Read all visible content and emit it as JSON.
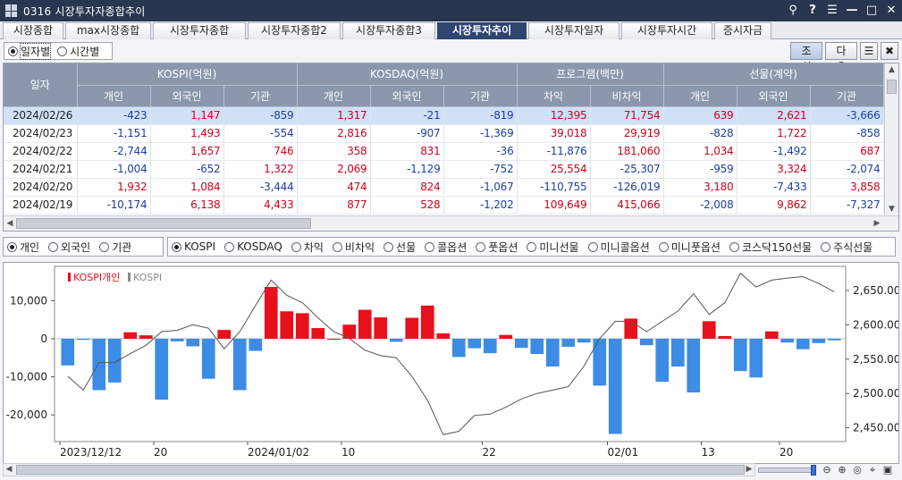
{
  "window": {
    "title": "0316 시장투자자종합추이",
    "buttons": [
      "pin",
      "?",
      "≡",
      "—",
      "□",
      "✕"
    ]
  },
  "tabs": [
    {
      "label": "시장종합",
      "active": false
    },
    {
      "label": "max시장종합",
      "active": false
    },
    {
      "label": "시장투자종합",
      "active": false
    },
    {
      "label": "시장투자종합2",
      "active": false
    },
    {
      "label": "시장투자종합3",
      "active": false
    },
    {
      "label": "시장투자추이",
      "active": true
    },
    {
      "label": "시장투자일자",
      "active": false
    },
    {
      "label": "시장투자시간",
      "active": false
    },
    {
      "label": "증시자금",
      "active": false
    }
  ],
  "toolbar": {
    "mode_options": [
      {
        "label": "일자별",
        "selected": true
      },
      {
        "label": "시간별",
        "selected": false
      }
    ],
    "query_label": "조회",
    "next_label": "다음"
  },
  "table": {
    "date_header": "일자",
    "groups": [
      "KOSPI(억원)",
      "KOSDAQ(억원)",
      "프로그램(백만)",
      "선물(계약)"
    ],
    "subheaders": [
      "개인",
      "외국인",
      "기관",
      "개인",
      "외국인",
      "기관",
      "차익",
      "비차익",
      "개인",
      "외국인",
      "기관"
    ],
    "rows": [
      {
        "date": "2024/02/26",
        "values": [
          "-423",
          "1,147",
          "-859",
          "1,317",
          "-21",
          "-819",
          "12,395",
          "71,754",
          "639",
          "2,621",
          "-3,666"
        ]
      },
      {
        "date": "2024/02/23",
        "values": [
          "-1,151",
          "1,493",
          "-554",
          "2,816",
          "-907",
          "-1,369",
          "39,018",
          "29,919",
          "-828",
          "1,722",
          "-858"
        ]
      },
      {
        "date": "2024/02/22",
        "values": [
          "-2,744",
          "1,657",
          "746",
          "358",
          "831",
          "-36",
          "-11,876",
          "181,060",
          "1,034",
          "-1,492",
          "687"
        ]
      },
      {
        "date": "2024/02/21",
        "values": [
          "-1,004",
          "-652",
          "1,322",
          "2,069",
          "-1,129",
          "-752",
          "25,554",
          "-25,307",
          "-959",
          "3,324",
          "-2,074"
        ]
      },
      {
        "date": "2024/02/20",
        "values": [
          "1,932",
          "1,084",
          "-3,444",
          "474",
          "824",
          "-1,067",
          "-110,755",
          "-126,019",
          "3,180",
          "-7,433",
          "3,858"
        ]
      },
      {
        "date": "2024/02/19",
        "values": [
          "-10,174",
          "6,138",
          "4,433",
          "877",
          "528",
          "-1,202",
          "109,649",
          "415,066",
          "-2,008",
          "9,862",
          "-7,327"
        ]
      }
    ]
  },
  "investor_options": [
    {
      "label": "개인",
      "selected": true
    },
    {
      "label": "외국인",
      "selected": false
    },
    {
      "label": "기관",
      "selected": false
    }
  ],
  "market_options": [
    {
      "label": "KOSPI",
      "selected": true
    },
    {
      "label": "KOSDAQ",
      "selected": false
    },
    {
      "label": "차익",
      "selected": false
    },
    {
      "label": "비차익",
      "selected": false
    },
    {
      "label": "선물",
      "selected": false
    },
    {
      "label": "콜옵션",
      "selected": false
    },
    {
      "label": "풋옵션",
      "selected": false
    },
    {
      "label": "미니선물",
      "selected": false
    },
    {
      "label": "미니콜옵션",
      "selected": false
    },
    {
      "label": "미니풋옵션",
      "selected": false
    },
    {
      "label": "코스닥150선물",
      "selected": false
    },
    {
      "label": "주식선물",
      "selected": false
    }
  ],
  "colors": {
    "positive": "#d0021b",
    "negative": "#1d3ea8",
    "bar_up": "#e8101a",
    "bar_down": "#3c8ce6",
    "line": "#555555"
  },
  "chart_data": {
    "type": "bar",
    "legend": [
      {
        "name": "KOSPI개인",
        "color": "#e8101a"
      },
      {
        "name": "KOSPI",
        "color": "#888888"
      }
    ],
    "x_tick_labels": [
      "2023/12/12",
      "20",
      "2024/01/02",
      "10",
      "22",
      "02/01",
      "13",
      "20"
    ],
    "x_tick_index": [
      0,
      6,
      12,
      18,
      27,
      35,
      41,
      46
    ],
    "y_left": {
      "ticks": [
        10000,
        0,
        -10000,
        -20000
      ],
      "tick_labels": [
        "10,000",
        "0",
        "-10,000",
        "-20,000"
      ],
      "range": [
        -27000,
        19000
      ]
    },
    "y_right": {
      "ticks": [
        2650,
        2600,
        2550,
        2500,
        2450
      ],
      "tick_labels": [
        "2,650.00",
        "2,600.00",
        "2,550.00",
        "2,500.00",
        "2,450.00"
      ],
      "range": [
        2430,
        2685
      ]
    },
    "series": [
      {
        "name": "KOSPI개인",
        "kind": "bar",
        "values": [
          -7000,
          -300,
          -13500,
          -11500,
          1700,
          900,
          -16000,
          -700,
          -2000,
          -10500,
          2300,
          -13500,
          -3200,
          13600,
          7200,
          6700,
          2800,
          0,
          3700,
          7600,
          5600,
          -800,
          5500,
          8700,
          1400,
          -4800,
          -2500,
          -3800,
          1000,
          -2400,
          -4000,
          -7300,
          -2100,
          -1000,
          -12300,
          -25000,
          5300,
          -1700,
          -11300,
          -7300,
          -14100,
          4600,
          700,
          -8500,
          -10174,
          1932,
          -1004,
          -2744,
          -1151,
          -423
        ]
      },
      {
        "name": "KOSPI",
        "kind": "line",
        "values": [
          2525,
          2505,
          2545,
          2545,
          2558,
          2570,
          2590,
          2592,
          2600,
          2595,
          2565,
          2590,
          2628,
          2665,
          2643,
          2632,
          2610,
          2590,
          2580,
          2563,
          2555,
          2552,
          2525,
          2490,
          2440,
          2445,
          2468,
          2470,
          2480,
          2492,
          2500,
          2505,
          2510,
          2540,
          2580,
          2605,
          2605,
          2590,
          2605,
          2620,
          2645,
          2615,
          2632,
          2675,
          2655,
          2665,
          2668,
          2670,
          2660,
          2648
        ]
      }
    ]
  }
}
